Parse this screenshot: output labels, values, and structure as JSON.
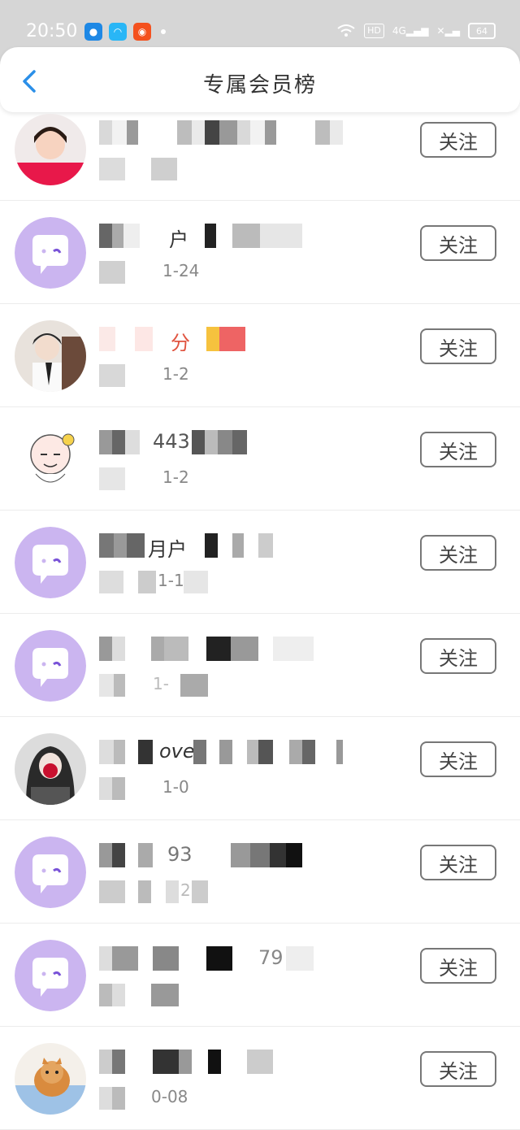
{
  "status_bar": {
    "time": "20:50",
    "network_label": "4G",
    "hd_label": "HD",
    "battery": "64"
  },
  "header": {
    "title": "专属会员榜"
  },
  "follow_label": "关注",
  "members": [
    {
      "name": "",
      "date": "",
      "avatar": "photo-girl-red"
    },
    {
      "name": "户_",
      "date": "1-24",
      "avatar": "default-chat-icon"
    },
    {
      "name": "分",
      "date": "1-2",
      "avatar": "photo-boy-tie"
    },
    {
      "name": "443",
      "date": "1-2",
      "avatar": "cartoon-bear-girl"
    },
    {
      "name": "月户",
      "date": "1-1",
      "avatar": "default-chat-icon"
    },
    {
      "name": "",
      "date": "1-",
      "avatar": "default-chat-icon"
    },
    {
      "name": "ove",
      "date": "1-0",
      "avatar": "anime-girl-mask"
    },
    {
      "name": "93",
      "date": "2",
      "avatar": "default-chat-icon"
    },
    {
      "name": "79",
      "date": "",
      "avatar": "default-chat-icon"
    },
    {
      "name": "",
      "date": "0-08",
      "avatar": "photo-cat"
    }
  ]
}
